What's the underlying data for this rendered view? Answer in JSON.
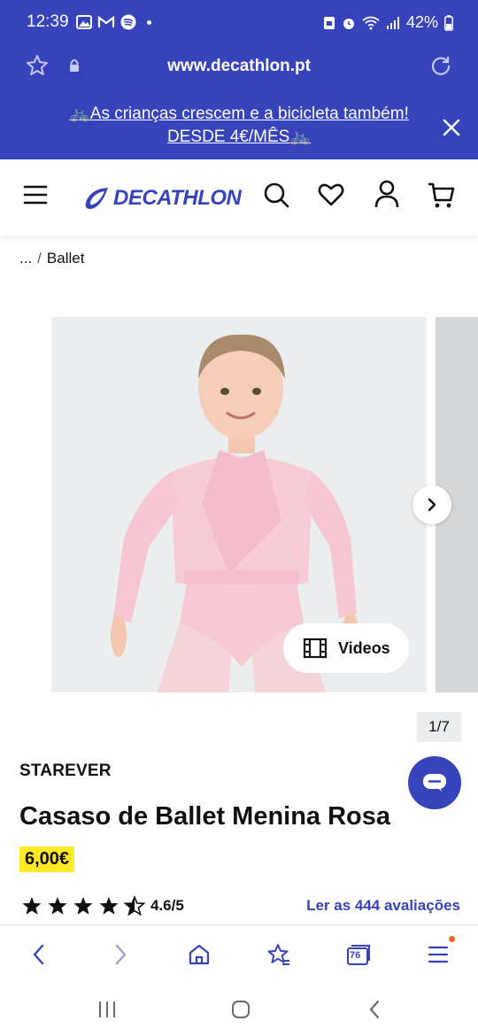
{
  "status_bar": {
    "time": "12:39",
    "battery": "42%"
  },
  "browser": {
    "url": "www.decathlon.pt"
  },
  "promo": {
    "line1": "🚲As crianças crescem e a bicicleta também!",
    "line2": "DESDE 4€/MÊS🚲"
  },
  "header": {
    "logo": "DECATHLON"
  },
  "breadcrumb": {
    "ellipsis": "...",
    "separator": "/",
    "current": "Ballet"
  },
  "gallery": {
    "videos_label": "Videos",
    "counter": "1/7"
  },
  "product": {
    "brand": "STAREVER",
    "title": "Casaso de Ballet Menina Rosa",
    "price": "6,00€",
    "rating": "4.6/5",
    "rating_value": 4.6,
    "reviews_link": "Ler as 444 avaliações"
  },
  "browser_toolbar": {
    "tabs_count": "76"
  },
  "colors": {
    "brand": "#3643BA",
    "price_highlight": "#FFEA28"
  }
}
